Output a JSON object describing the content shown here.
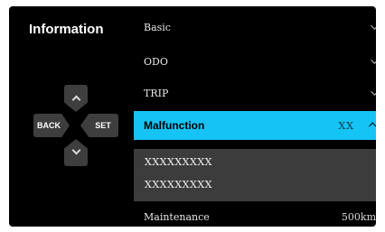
{
  "title": "Information",
  "dpad": {
    "back_label": "BACK",
    "set_label": "SET"
  },
  "menu": {
    "items": [
      {
        "label": "Basic",
        "value": ""
      },
      {
        "label": "ODO",
        "value": ""
      },
      {
        "label": "TRIP",
        "value": ""
      },
      {
        "label": "Malfunction",
        "value": "XX"
      },
      {
        "label": "Maintenance",
        "value": "500km"
      }
    ],
    "malfunction_subitems": [
      "XXXXXXXXX",
      "XXXXXXXXX"
    ]
  },
  "colors": {
    "highlight": "#16c3f5",
    "panel": "#000000",
    "subpanel": "#3c3c3c",
    "dpad": "#3e3e3e"
  }
}
